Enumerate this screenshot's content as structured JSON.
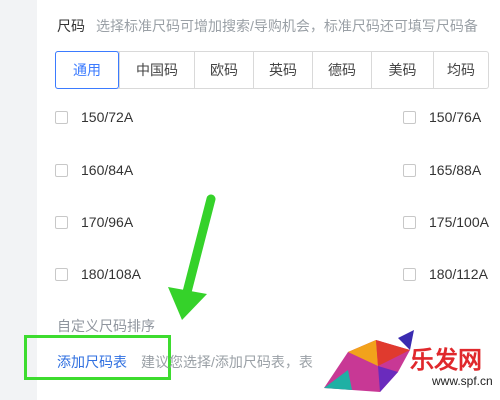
{
  "size": {
    "title": "尺码",
    "hint": "选择标准尺码可增加搜索/导购机会，标准尺码还可填写尺码备"
  },
  "tabs": [
    {
      "label": "通用",
      "active": true
    },
    {
      "label": "中国码",
      "active": false
    },
    {
      "label": "欧码",
      "active": false
    },
    {
      "label": "英码",
      "active": false
    },
    {
      "label": "德码",
      "active": false
    },
    {
      "label": "美码",
      "active": false
    },
    {
      "label": "均码",
      "active": false
    }
  ],
  "options": [
    {
      "label": "150/72A",
      "checked": false
    },
    {
      "label": "150/76A",
      "checked": false
    },
    {
      "label": "160/84A",
      "checked": false
    },
    {
      "label": "165/88A",
      "checked": false
    },
    {
      "label": "170/96A",
      "checked": false
    },
    {
      "label": "175/100A",
      "checked": false
    },
    {
      "label": "180/108A",
      "checked": false
    },
    {
      "label": "180/112A",
      "checked": false
    }
  ],
  "custom_sort_label": "自定义尺码排序",
  "add_size_table": {
    "link": "添加尺码表",
    "hint": "建议您选择/添加尺码表，​表"
  },
  "watermark": {
    "brand": "乐发网",
    "url": "www.spf.cn"
  },
  "colors": {
    "accent": "#3b7bff",
    "highlight": "#3ddc2f",
    "watermark": "#e0282c"
  }
}
